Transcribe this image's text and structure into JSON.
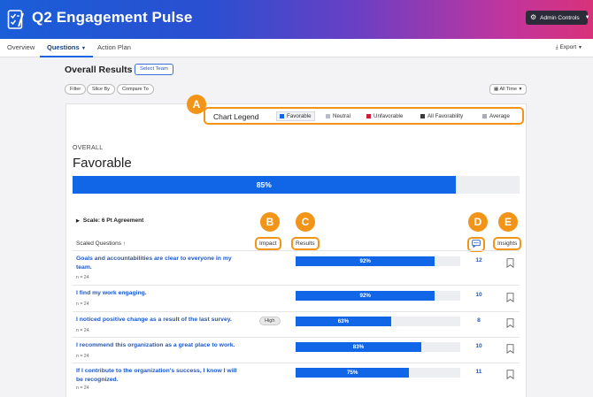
{
  "app": {
    "title": "Q2 Engagement Pulse",
    "admin_label": "Admin Controls"
  },
  "nav": {
    "tabs": [
      {
        "label": "Overview",
        "active": false
      },
      {
        "label": "Questions",
        "active": true
      },
      {
        "label": "Action Plan",
        "active": false
      }
    ],
    "export_label": "Export"
  },
  "toolbar": {
    "title": "Overall Results",
    "select_team": "Select Team",
    "filters": [
      "Filter",
      "Slice By",
      "Compare To"
    ],
    "time_range": "All Time"
  },
  "legend": {
    "title": "Chart Legend",
    "items": [
      {
        "label": "Favorable",
        "color": "#1166e8"
      },
      {
        "label": "Neutral",
        "color": "#b8bcc6"
      },
      {
        "label": "Unfavorable",
        "color": "#cc1f3a"
      },
      {
        "label": "All Favorability",
        "color": "#3a3a3a"
      },
      {
        "label": "Average",
        "color": "#a7abb5"
      }
    ]
  },
  "callouts": [
    "A",
    "B",
    "C",
    "D",
    "E"
  ],
  "overall": {
    "label": "OVERALL",
    "value_label": "Favorable",
    "percent": 85,
    "percent_label": "85%"
  },
  "scale": {
    "label": "Scale: 6 Pt Agreement"
  },
  "columns": {
    "questions": "Scaled Questions",
    "impact": "Impact",
    "results": "Results",
    "insights": "Insights"
  },
  "questions": [
    {
      "text": "Goals and accountabilities are clear to everyone in my team.",
      "n": "n = 24",
      "impact": "",
      "percent": 92,
      "percent_label": "92%",
      "comments": "12"
    },
    {
      "text": "I find my work engaging.",
      "n": "n = 24",
      "impact": "",
      "percent": 92,
      "percent_label": "92%",
      "comments": "10"
    },
    {
      "text": "I noticed positive change as a result of the last survey.",
      "n": "n = 24",
      "impact": "High",
      "percent": 63,
      "percent_label": "63%",
      "comments": "8"
    },
    {
      "text": "I recommend this organization as a great place to work.",
      "n": "n = 24",
      "impact": "",
      "percent": 83,
      "percent_label": "83%",
      "comments": "10"
    },
    {
      "text": "If I contribute to the organization's success, I know I will be recognized.",
      "n": "n = 24",
      "impact": "",
      "percent": 75,
      "percent_label": "75%",
      "comments": "11"
    }
  ]
}
